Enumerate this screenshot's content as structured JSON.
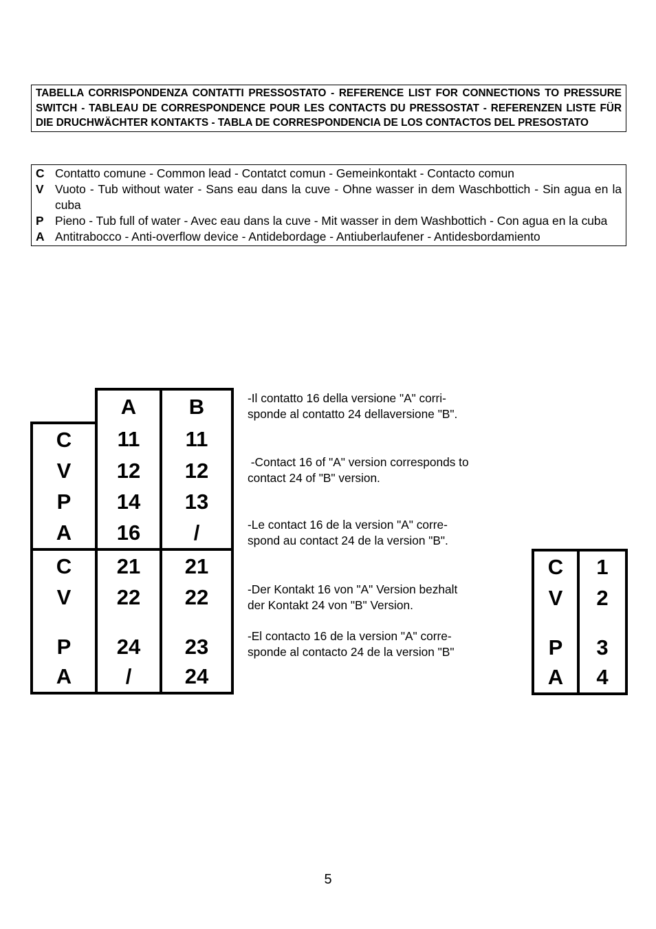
{
  "title_box": {
    "text": "TABELLA CORRISPONDENZA CONTATTI PRESSOSTATO - REFERENCE LIST FOR CONNECTIONS TO PRESSURE SWITCH - TABLEAU DE CORRESPONDENCE POUR LES CONTACTS DU PRESSOSTAT - REFERENZEN LISTE FÜR DIE DRUCHWÄCHTER KONTAKTS - TABLA DE CORRESPONDENCIA DE LOS CONTACTOS DEL PRESOSTATO"
  },
  "legend": [
    {
      "key": "C",
      "desc": "Contatto comune - Common lead - Contatct comun - Gemeinkontakt - Contacto comun"
    },
    {
      "key": "V",
      "desc": "Vuoto - Tub without water - Sans eau dans la cuve - Ohne wasser in dem Waschbottich - Sin agua en la cuba"
    },
    {
      "key": "P",
      "desc": "Pieno - Tub full of water - Avec eau dans la cuve - Mit wasser in dem Washbottich - Con agua en la cuba"
    },
    {
      "key": "A",
      "desc": "Antitrabocco - Anti-overflow device - Antidebordage - Antiuberlaufener - Antidesbordamiento"
    }
  ],
  "main_table": {
    "headers": [
      "",
      "A",
      "B"
    ],
    "group1": [
      {
        "key": "C",
        "a": "11",
        "b": "11"
      },
      {
        "key": "V",
        "a": "12",
        "b": "12"
      },
      {
        "key": "P",
        "a": "14",
        "b": "13"
      },
      {
        "key": "A",
        "a": "16",
        "b": "/"
      }
    ],
    "group2": [
      {
        "key": "C",
        "a": "21",
        "b": "21"
      },
      {
        "key": "V",
        "a": "22",
        "b": "22"
      },
      {
        "key": "P",
        "a": "24",
        "b": "23"
      },
      {
        "key": "A",
        "a": "/",
        "b": "24"
      }
    ]
  },
  "notes": [
    {
      "line1": "-Il contatto 16 della versione \"A\" corri-",
      "line2": "sponde al contatto 24 dellaversione \"B\"."
    },
    {
      "line1": " -Contact 16 of \"A\" version corresponds to",
      "line2": "contact 24 of \"B\" version."
    },
    {
      "line1": "-Le contact 16 de la version \"A\" corre-",
      "line2": "spond au contact 24 de la version \"B\"."
    },
    {
      "line1": "-Der Kontakt 16 von \"A\" Version bezhalt",
      "line2": "der Kontakt 24 von \"B\" Version."
    },
    {
      "line1": "-El contacto 16 de la version \"A\" corre-",
      "line2": "sponde al contacto 24 de la version \"B\""
    }
  ],
  "small_table": [
    {
      "key": "C",
      "value": "1"
    },
    {
      "key": "V",
      "value": "2"
    },
    {
      "key": "P",
      "value": "3"
    },
    {
      "key": "A",
      "value": "4"
    }
  ],
  "page_number": "5"
}
